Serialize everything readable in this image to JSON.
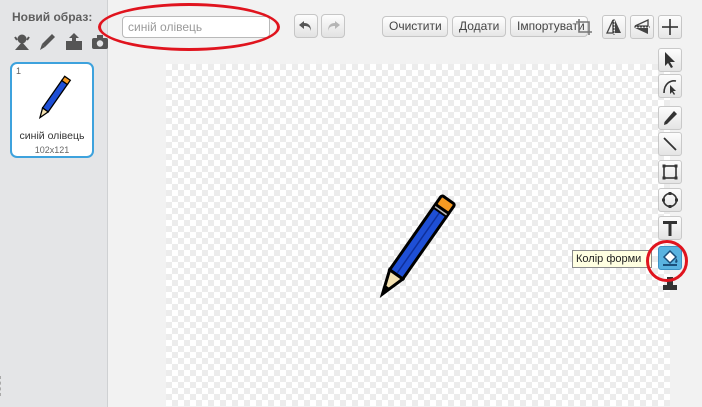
{
  "costume_panel": {
    "new_costume_label": "Новий образ:",
    "new_costume_icons": [
      "sprite-library-icon",
      "paint-brush-icon",
      "upload-icon",
      "camera-icon"
    ],
    "costumes": [
      {
        "index": "1",
        "name": "синій олівець",
        "size": "102x121",
        "selected": true
      }
    ]
  },
  "editor": {
    "costume_name_placeholder": "синій олівець",
    "undo_icon": "undo-icon",
    "redo_icon": "redo-icon",
    "buttons": {
      "clear": "Очистити",
      "add": "Додати",
      "import": "Імпортувати"
    },
    "top_tools": [
      "crop-icon",
      "flip-horizontal-icon",
      "flip-vertical-icon",
      "set-center-icon"
    ],
    "side_tools": [
      "select-icon",
      "reshape-icon",
      "pencil-icon",
      "line-icon",
      "rectangle-icon",
      "ellipse-icon",
      "text-icon",
      "fill-bucket-icon",
      "stamp-icon"
    ],
    "active_tool": "fill-bucket-icon",
    "tooltip": "Колір форми"
  },
  "colors": {
    "accent": "#3da2dd",
    "active_tool": "#5ab3e0",
    "highlight_ring": "#e0141e",
    "pencil_body": "#1e4fd6",
    "pencil_eraser": "#f59a22"
  }
}
